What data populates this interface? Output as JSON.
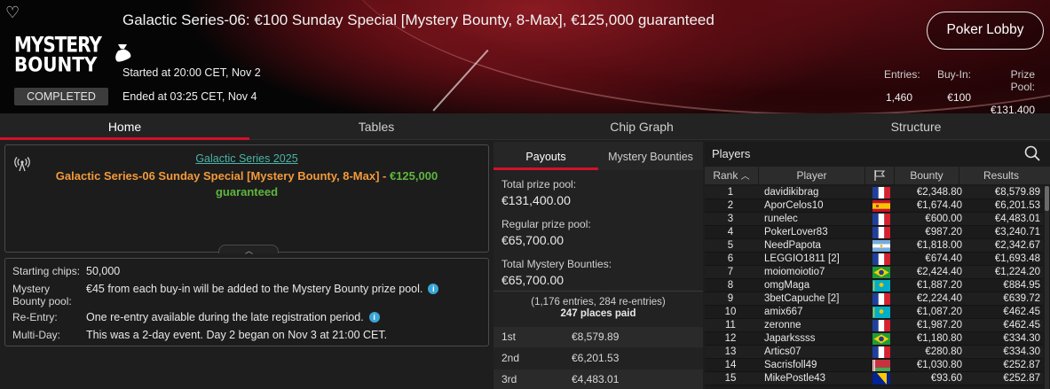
{
  "header": {
    "title": "Galactic Series-06: €100 Sunday Special [Mystery Bounty, 8-Max], €125,000 guaranteed",
    "logo_line1": "MYSTERY",
    "logo_line2": "BOUNTY",
    "status": "COMPLETED",
    "started": "Started at 20:00 CET, Nov 2",
    "ended": "Ended at 03:25 CET, Nov 4",
    "lobby_button": "Poker Lobby",
    "stats": {
      "entries_label": "Entries:",
      "entries_value": "1,460",
      "buyin_label": "Buy-In:",
      "buyin_value": "€100",
      "prizepool_label": "Prize Pool:",
      "prizepool_value": "€131,400"
    }
  },
  "nav": {
    "tabs": [
      "Home",
      "Tables",
      "Chip Graph",
      "Structure"
    ],
    "active": 0
  },
  "info": {
    "series_link": "Galactic Series 2025",
    "name_orange": "Galactic Series-06 Sunday Special [Mystery Bounty, 8-Max]",
    "name_dash": " - ",
    "name_green1": "€125,000",
    "name_green2": "guaranteed"
  },
  "details": {
    "starting_chips_label": "Starting chips:",
    "starting_chips_value": "50,000",
    "bounty_pool_label1": "Mystery",
    "bounty_pool_label2": "Bounty pool:",
    "bounty_pool_value": "€45 from each buy-in will be added to the Mystery Bounty prize pool.",
    "reentry_label": "Re-Entry:",
    "reentry_value": "One re-entry available during the late registration period.",
    "multiday_label": "Multi-Day:",
    "multiday_value": "This was a 2-day event. Day 2 began on Nov 3 at 21:00 CET."
  },
  "payouts": {
    "tabs": [
      "Payouts",
      "Mystery Bounties"
    ],
    "total_label": "Total prize pool:",
    "total_value": "€131,400.00",
    "regular_label": "Regular prize pool:",
    "regular_value": "€65,700.00",
    "bounties_label": "Total Mystery Bounties:",
    "bounties_value": "€65,700.00",
    "entries_note": "(1,176 entries, 284 re-entries)",
    "places_paid": "247 places paid",
    "rows": [
      {
        "place": "1st",
        "amount": "€8,579.89"
      },
      {
        "place": "2nd",
        "amount": "€6,201.53"
      },
      {
        "place": "3rd",
        "amount": "€4,483.01"
      }
    ]
  },
  "players": {
    "title": "Players",
    "columns": {
      "rank": "Rank",
      "player": "Player",
      "bounty": "Bounty",
      "results": "Results"
    },
    "rows": [
      {
        "rank": "1",
        "name": "davidikibrag",
        "flag": "fr",
        "bounty": "€2,348.80",
        "result": "€8,579.89"
      },
      {
        "rank": "2",
        "name": "AporCelos10",
        "flag": "es",
        "bounty": "€1,674.40",
        "result": "€6,201.53"
      },
      {
        "rank": "3",
        "name": "runelec",
        "flag": "fr",
        "bounty": "€600.00",
        "result": "€4,483.01"
      },
      {
        "rank": "4",
        "name": "PokerLover83",
        "flag": "fr",
        "bounty": "€987.20",
        "result": "€3,240.71"
      },
      {
        "rank": "5",
        "name": "NeedPapota",
        "flag": "ar",
        "bounty": "€1,818.00",
        "result": "€2,342.67"
      },
      {
        "rank": "6",
        "name": "LEGGIO1811 [2]",
        "flag": "fr",
        "bounty": "€674.40",
        "result": "€1,693.48"
      },
      {
        "rank": "7",
        "name": "moiomoiotio7",
        "flag": "br",
        "bounty": "€2,424.40",
        "result": "€1,224.20"
      },
      {
        "rank": "8",
        "name": "omgMaga",
        "flag": "kz",
        "bounty": "€1,887.20",
        "result": "€884.95"
      },
      {
        "rank": "9",
        "name": "3betCapuche [2]",
        "flag": "fr",
        "bounty": "€2,224.40",
        "result": "€639.72"
      },
      {
        "rank": "10",
        "name": "amix667",
        "flag": "kz",
        "bounty": "€1,087.20",
        "result": "€462.45"
      },
      {
        "rank": "11",
        "name": "zeronne",
        "flag": "fr",
        "bounty": "€1,987.20",
        "result": "€462.45"
      },
      {
        "rank": "12",
        "name": "Japarkssss",
        "flag": "br",
        "bounty": "€1,180.80",
        "result": "€334.30"
      },
      {
        "rank": "13",
        "name": "Artics07",
        "flag": "fr",
        "bounty": "€280.80",
        "result": "€334.30"
      },
      {
        "rank": "14",
        "name": "Sacrisfoll49",
        "flag": "by",
        "bounty": "€1,030.80",
        "result": "€252.87"
      },
      {
        "rank": "15",
        "name": "MikePostle43",
        "flag": "ba",
        "bounty": "€93.60",
        "result": "€252.87"
      }
    ]
  }
}
